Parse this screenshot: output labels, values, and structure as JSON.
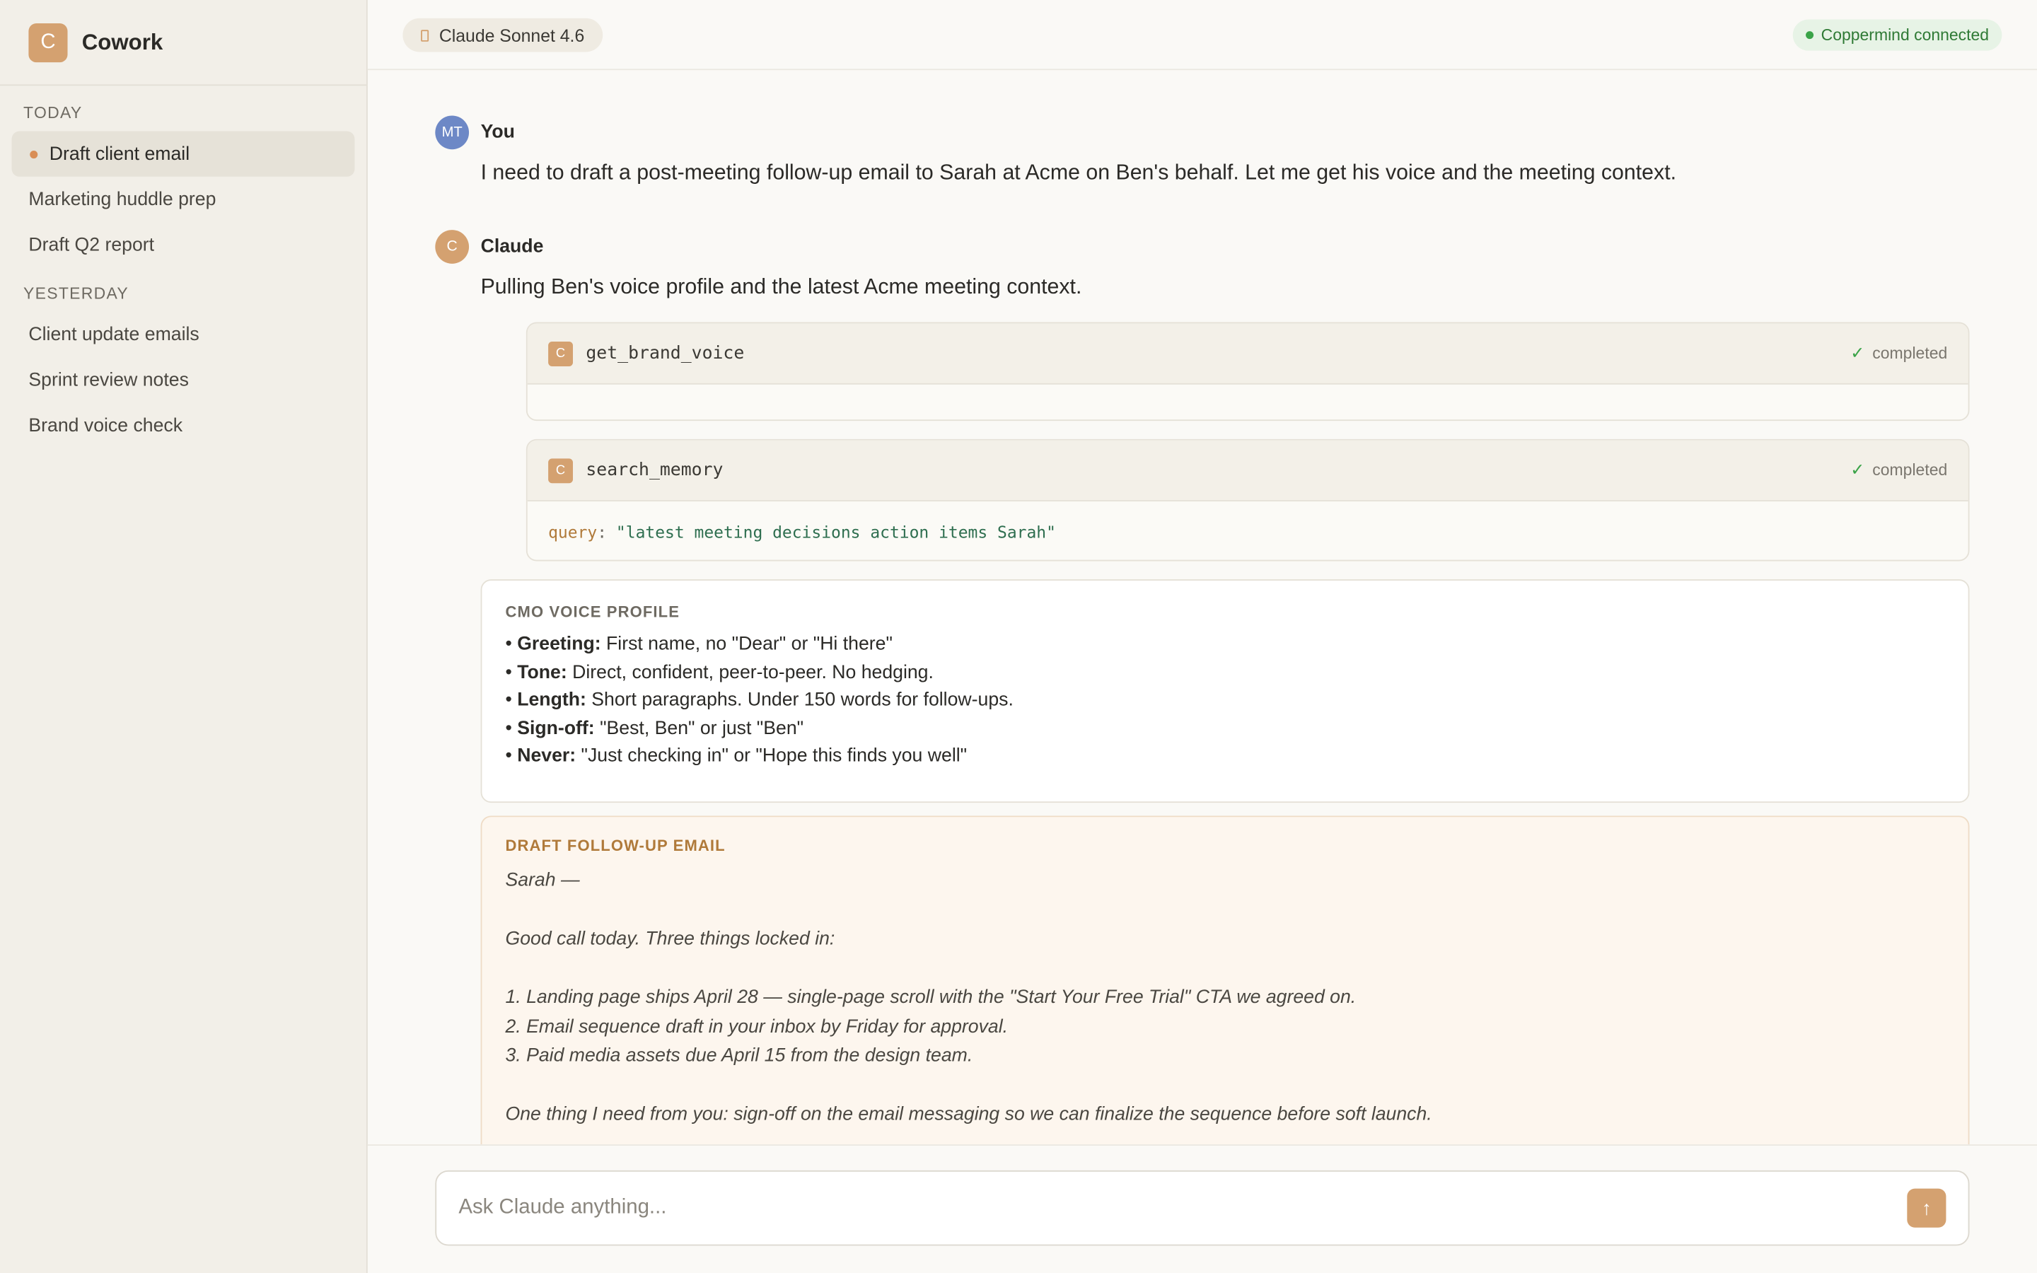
{
  "sidebar": {
    "brand_logo": "C",
    "brand_name": "Cowork",
    "sections": [
      {
        "label": "TODAY",
        "items": [
          "Draft client email",
          "Marketing huddle prep",
          "Draft Q2 report"
        ]
      },
      {
        "label": "YESTERDAY",
        "items": [
          "Client update emails",
          "Sprint review notes",
          "Brand voice check"
        ]
      }
    ],
    "active_item": "Draft client email"
  },
  "topbar": {
    "model_label": "Claude Sonnet 4.6",
    "connection_status": "Coppermind connected"
  },
  "conversation": {
    "user": {
      "avatar": "MT",
      "name": "You",
      "message": "I need to draft a post-meeting follow-up email to Sarah at Acme on Ben's behalf. Let me get his voice and the meeting context."
    },
    "assistant": {
      "avatar": "C",
      "name": "Claude",
      "message": "Pulling Ben's voice profile and the latest Acme meeting context.",
      "tool_calls": [
        {
          "icon": "C",
          "name": "get_brand_voice",
          "status": "completed",
          "param_key": "",
          "param_sep": "",
          "param_value": ""
        },
        {
          "icon": "C",
          "name": "search_memory",
          "status": "completed",
          "param_key": "query",
          "param_sep": ":",
          "param_value": "\"latest meeting decisions action items Sarah\""
        }
      ]
    }
  },
  "voice_profile": {
    "title": "CMO VOICE PROFILE",
    "items": [
      {
        "label": "Greeting:",
        "text": "First name, no \"Dear\" or \"Hi there\""
      },
      {
        "label": "Tone:",
        "text": "Direct, confident, peer-to-peer. No hedging."
      },
      {
        "label": "Length:",
        "text": "Short paragraphs. Under 150 words for follow-ups."
      },
      {
        "label": "Sign-off:",
        "text": "\"Best, Ben\" or just \"Ben\""
      },
      {
        "label": "Never:",
        "text": "\"Just checking in\" or \"Hope this finds you well\""
      }
    ]
  },
  "draft_email": {
    "title": "DRAFT FOLLOW-UP EMAIL",
    "lines": [
      "Sarah —",
      "",
      "Good call today. Three things locked in:",
      "",
      "1. Landing page ships April 28 — single-page scroll with the \"Start Your Free Trial\" CTA we agreed on.",
      "2. Email sequence draft in your inbox by Friday for approval.",
      "3. Paid media assets due April 15 from the design team.",
      "",
      "One thing I need from you: sign-off on the email messaging so we can finalize the sequence before soft launch."
    ]
  },
  "composer": {
    "placeholder": "Ask Claude anything...",
    "send_icon": "arrow-up-icon",
    "send_glyph": "↑"
  },
  "colors": {
    "accent": "#d4a170",
    "sidebar_bg": "#f2efe8",
    "status_green": "#3aa348",
    "draft_bg": "#fdf6ee"
  }
}
